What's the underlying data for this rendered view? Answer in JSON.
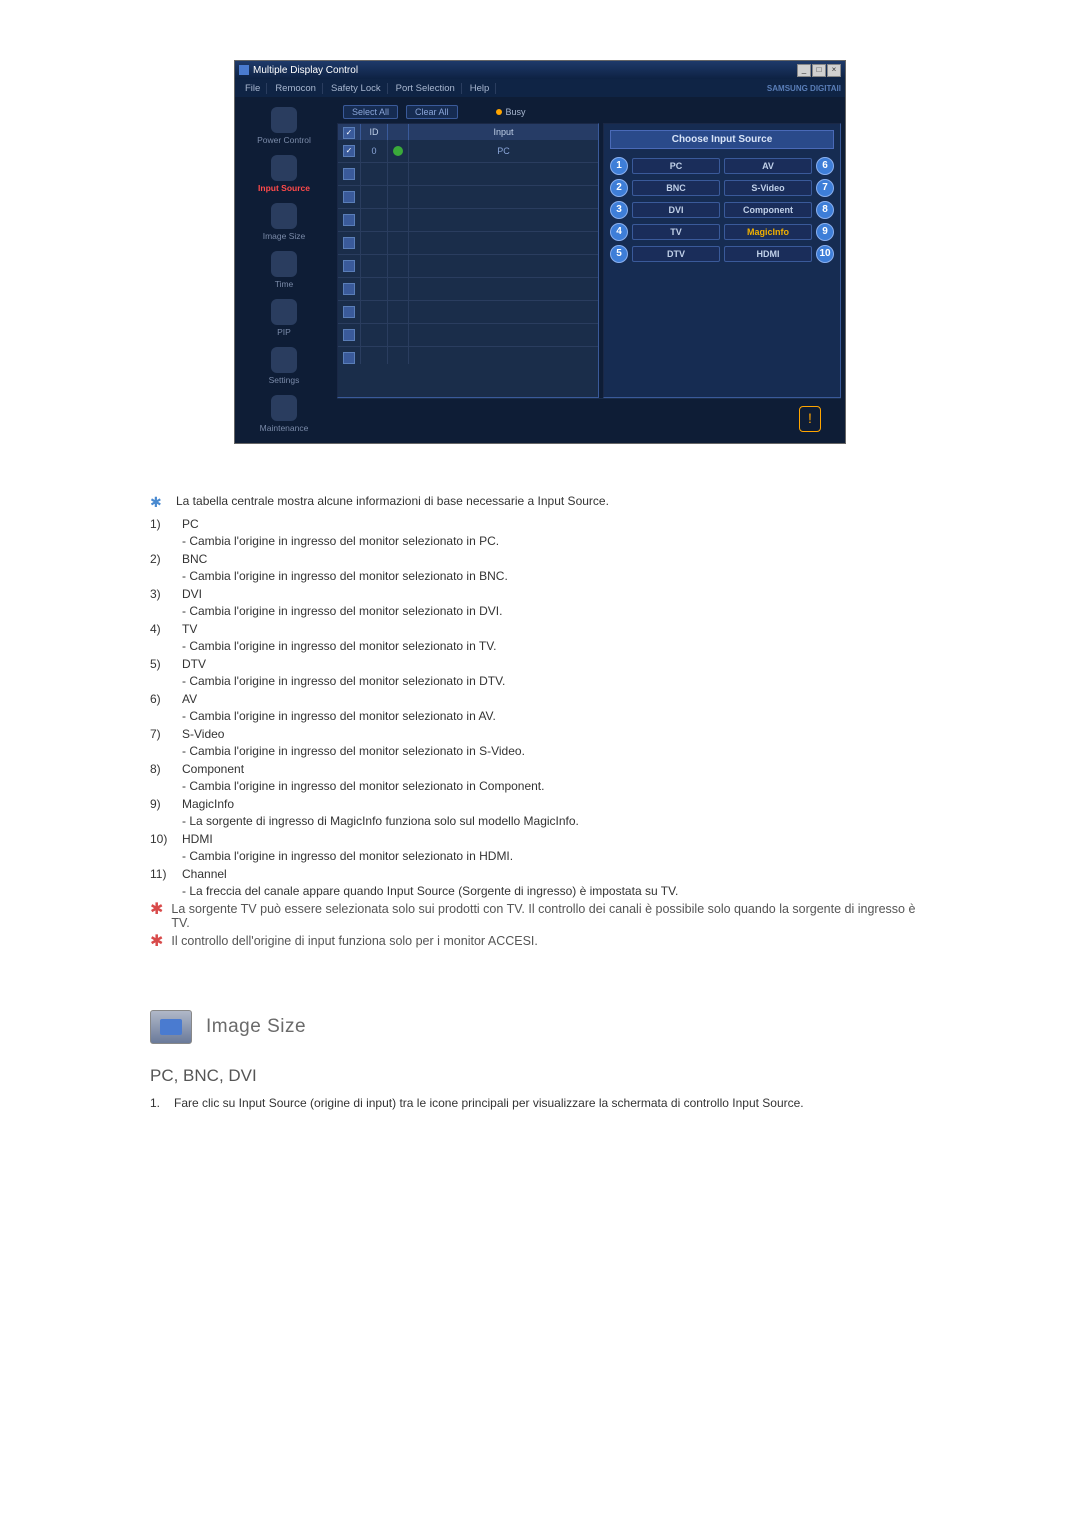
{
  "window": {
    "title": "Multiple Display Control",
    "minimize": "_",
    "maximize": "□",
    "close": "×"
  },
  "menu": {
    "file": "File",
    "remocon": "Remocon",
    "safety_lock": "Safety Lock",
    "port_selection": "Port Selection",
    "help": "Help",
    "brand": "SAMSUNG DIGITAll"
  },
  "sidebar": {
    "items": [
      {
        "label": "Power Control",
        "active": false
      },
      {
        "label": "Input Source",
        "active": true
      },
      {
        "label": "Image Size",
        "active": false
      },
      {
        "label": "Time",
        "active": false
      },
      {
        "label": "PIP",
        "active": false
      },
      {
        "label": "Settings",
        "active": false
      },
      {
        "label": "Maintenance",
        "active": false
      }
    ]
  },
  "toolbar": {
    "select_all": "Select All",
    "clear_all": "Clear All",
    "busy": "Busy"
  },
  "table": {
    "headers": {
      "id": "ID",
      "input": "Input"
    },
    "rows": [
      {
        "checked": true,
        "id": "0",
        "status": "green",
        "input": "PC"
      },
      {
        "checked": false,
        "id": "",
        "status": "",
        "input": ""
      },
      {
        "checked": false,
        "id": "",
        "status": "",
        "input": ""
      },
      {
        "checked": false,
        "id": "",
        "status": "",
        "input": ""
      },
      {
        "checked": false,
        "id": "",
        "status": "",
        "input": ""
      },
      {
        "checked": false,
        "id": "",
        "status": "",
        "input": ""
      },
      {
        "checked": false,
        "id": "",
        "status": "",
        "input": ""
      },
      {
        "checked": false,
        "id": "",
        "status": "",
        "input": ""
      },
      {
        "checked": false,
        "id": "",
        "status": "",
        "input": ""
      },
      {
        "checked": false,
        "id": "",
        "status": "",
        "input": ""
      }
    ]
  },
  "panel": {
    "heading": "Choose Input Source",
    "sources": {
      "s1": {
        "num": "1",
        "label": "PC"
      },
      "s2": {
        "num": "2",
        "label": "BNC"
      },
      "s3": {
        "num": "3",
        "label": "DVI"
      },
      "s4": {
        "num": "4",
        "label": "TV"
      },
      "s5": {
        "num": "5",
        "label": "DTV"
      },
      "s6": {
        "num": "6",
        "label": "AV"
      },
      "s7": {
        "num": "7",
        "label": "S-Video"
      },
      "s8": {
        "num": "8",
        "label": "Component"
      },
      "s9": {
        "num": "9",
        "label": "MagicInfo"
      },
      "s10": {
        "num": "10",
        "label": "HDMI"
      }
    }
  },
  "notes": {
    "intro": "La tabella centrale mostra alcune informazioni di base necessarie a Input Source.",
    "items": [
      {
        "num": "1)",
        "label": "PC",
        "desc": "- Cambia l'origine in ingresso del monitor selezionato in PC."
      },
      {
        "num": "2)",
        "label": "BNC",
        "desc": "- Cambia l'origine in ingresso del monitor selezionato in BNC."
      },
      {
        "num": "3)",
        "label": "DVI",
        "desc": "- Cambia l'origine in ingresso del monitor selezionato in DVI."
      },
      {
        "num": "4)",
        "label": "TV",
        "desc": "- Cambia l'origine in ingresso del monitor selezionato in TV."
      },
      {
        "num": "5)",
        "label": "DTV",
        "desc": "- Cambia l'origine in ingresso del monitor selezionato in DTV."
      },
      {
        "num": "6)",
        "label": "AV",
        "desc": "- Cambia l'origine in ingresso del monitor selezionato in AV."
      },
      {
        "num": "7)",
        "label": "S-Video",
        "desc": "- Cambia l'origine in ingresso del monitor selezionato in S-Video."
      },
      {
        "num": "8)",
        "label": "Component",
        "desc": "- Cambia l'origine in ingresso del monitor selezionato in Component."
      },
      {
        "num": "9)",
        "label": "MagicInfo",
        "desc": "- La sorgente di ingresso di MagicInfo funziona solo sul modello MagicInfo."
      },
      {
        "num": "10)",
        "label": "HDMI",
        "desc": "- Cambia l'origine in ingresso del monitor selezionato in HDMI."
      },
      {
        "num": "11)",
        "label": "Channel",
        "desc": "- La freccia del canale appare quando Input Source (Sorgente di ingresso) è impostata su TV."
      }
    ],
    "foot1": "La sorgente TV può essere selezionata solo sui prodotti con TV. Il controllo dei canali è possibile solo quando la sorgente di ingresso è TV.",
    "foot2": "Il controllo dell'origine di input funziona solo per i monitor ACCESI."
  },
  "section": {
    "heading": "Image Size",
    "sub_heading": "PC, BNC, DVI",
    "step1_num": "1.",
    "step1": "Fare clic su Input Source (origine di input) tra le icone principali per visualizzare la schermata di controllo Input Source."
  }
}
